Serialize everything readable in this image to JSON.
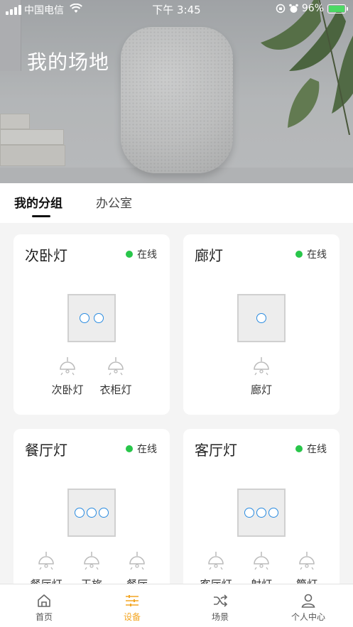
{
  "status_bar": {
    "carrier": "中国电信",
    "time": "下午 3:45",
    "battery": "96%"
  },
  "header": {
    "title": "我的场地"
  },
  "tabs": [
    {
      "label": "我的分组",
      "active": true
    },
    {
      "label": "办公室",
      "active": false
    }
  ],
  "devices": [
    {
      "name": "次卧灯",
      "status": "在线",
      "buttons": 2,
      "lights": [
        "次卧灯",
        "衣柜灯"
      ]
    },
    {
      "name": "廊灯",
      "status": "在线",
      "buttons": 1,
      "lights": [
        "廊灯"
      ]
    },
    {
      "name": "餐厅灯",
      "status": "在线",
      "buttons": 3,
      "lights": [
        "餐厅灯",
        "玉旅",
        "餐厅"
      ]
    },
    {
      "name": "客厅灯",
      "status": "在线",
      "buttons": 3,
      "lights": [
        "客厅灯",
        "射灯",
        "筒灯"
      ]
    }
  ],
  "bottom_nav": [
    {
      "label": "首页",
      "icon": "home-icon",
      "active": false
    },
    {
      "label": "设备",
      "icon": "sliders-icon",
      "active": true
    },
    {
      "label": "场景",
      "icon": "shuffle-icon",
      "active": false
    },
    {
      "label": "个人中心",
      "icon": "person-icon",
      "active": false
    }
  ],
  "colors": {
    "accent": "#f3a623",
    "online": "#28c64a",
    "switch_button": "#2a8be0"
  }
}
